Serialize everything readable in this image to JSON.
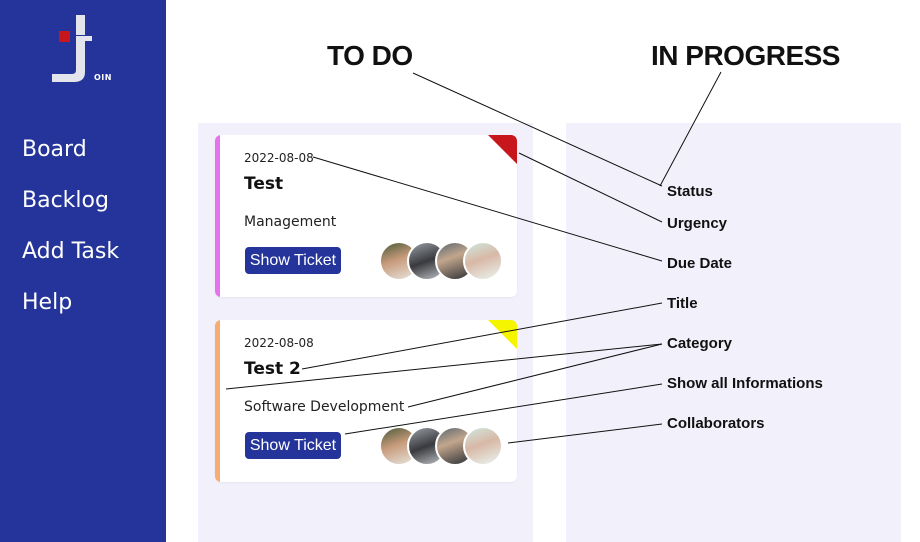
{
  "logo": {
    "text": "OIN"
  },
  "nav": {
    "items": [
      "Board",
      "Backlog",
      "Add Task",
      "Help"
    ]
  },
  "columns": {
    "todo": "TO DO",
    "in_progress": "IN PROGRESS"
  },
  "cards": [
    {
      "date": "2022-08-08",
      "title": "Test",
      "category": "Management",
      "button": "Show Ticket",
      "category_color": "#e573f0",
      "urgency_color": "#c8161d"
    },
    {
      "date": "2022-08-08",
      "title": "Test 2",
      "category": "Software Development",
      "button": "Show Ticket",
      "category_color": "#f6ad6f",
      "urgency_color": "#f6f500"
    }
  ],
  "legend": {
    "status": "Status",
    "urgency": "Urgency",
    "due_date": "Due Date",
    "title": "Title",
    "category": "Category",
    "show_all": "Show all Informations",
    "collaborators": "Collaborators"
  },
  "colors": {
    "sidebar": "#24349a",
    "column_bg": "#f2f1fb",
    "logo_red": "#c8161d"
  }
}
